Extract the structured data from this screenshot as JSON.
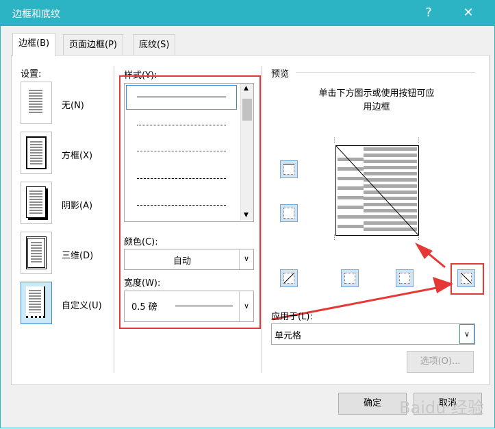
{
  "window": {
    "title": "边框和底纹",
    "help": "?",
    "close": "✕"
  },
  "tabs": [
    {
      "label": "边框(B)",
      "active": true
    },
    {
      "label": "页面边框(P)",
      "active": false
    },
    {
      "label": "底纹(S)",
      "active": false
    }
  ],
  "settings": {
    "heading": "设置:",
    "items": [
      {
        "label": "无(N)",
        "selected": false
      },
      {
        "label": "方框(X)",
        "selected": false
      },
      {
        "label": "阴影(A)",
        "selected": false
      },
      {
        "label": "三维(D)",
        "selected": false
      },
      {
        "label": "自定义(U)",
        "selected": true
      }
    ]
  },
  "style": {
    "label": "样式(Y):",
    "options": [
      "solid",
      "dotted",
      "fine-dashed",
      "dashed",
      "dash-dot"
    ],
    "selected_index": 0
  },
  "color": {
    "label": "颜色(C):",
    "value": "自动"
  },
  "width": {
    "label": "宽度(W):",
    "value": "0.5 磅"
  },
  "preview": {
    "heading": "预览",
    "instruction_line1": "单击下方图示或使用按钮可应",
    "instruction_line2": "用边框"
  },
  "apply_to": {
    "label": "应用于(L):",
    "value": "单元格"
  },
  "buttons": {
    "options": "选项(O)...",
    "ok": "确定",
    "cancel": "取消"
  },
  "watermark": "Baidu 经验",
  "colors": {
    "titlebar": "#2cb3c4",
    "highlight": "#e53935",
    "selected_fill": "#cde8f7"
  },
  "annotations": {
    "highlight_1": "style-color-width-group",
    "highlight_2": "diagonal-border-button"
  }
}
